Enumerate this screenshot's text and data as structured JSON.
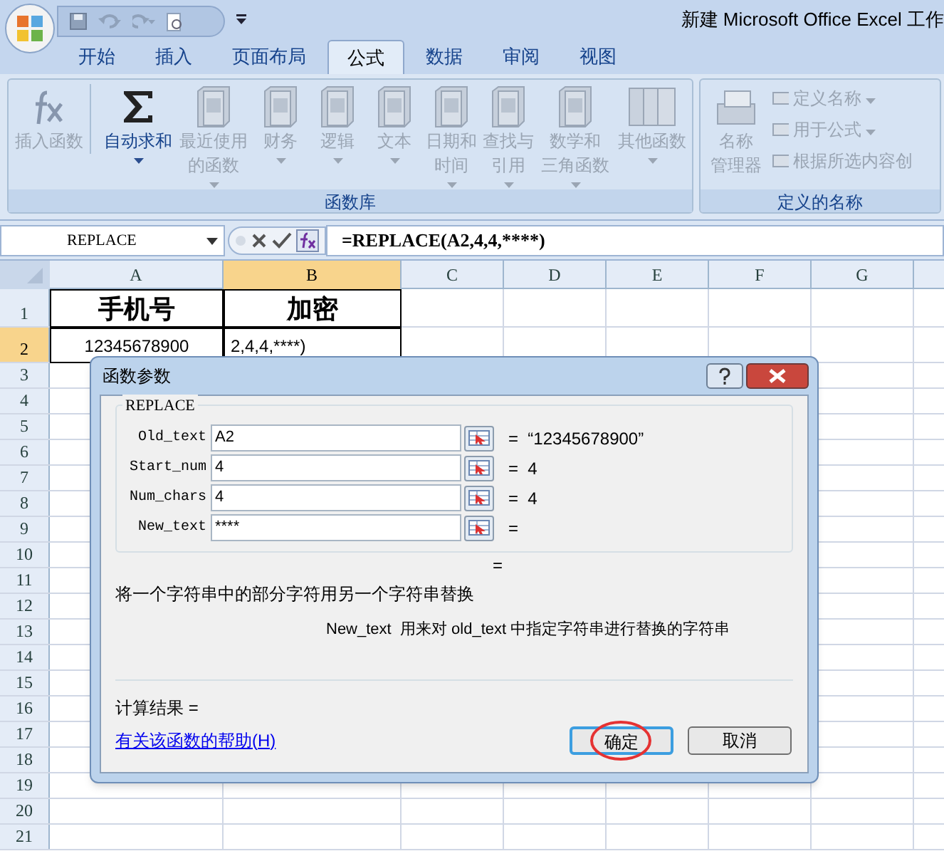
{
  "title_bar": {
    "title": "新建 Microsoft Office Excel 工作"
  },
  "ribbon_tabs": [
    {
      "label": "开始",
      "selected": false
    },
    {
      "label": "插入",
      "selected": false
    },
    {
      "label": "页面布局",
      "selected": false
    },
    {
      "label": "公式",
      "selected": true
    },
    {
      "label": "数据",
      "selected": false
    },
    {
      "label": "审阅",
      "selected": false
    },
    {
      "label": "视图",
      "selected": false
    }
  ],
  "ribbon": {
    "function_library": {
      "label": "函数库",
      "buttons": [
        {
          "kind": "fx",
          "lines": [
            "插入函数"
          ],
          "disabled": true,
          "dropdown": false
        },
        {
          "kind": "sigma",
          "lines": [
            "自动求和"
          ],
          "disabled": false,
          "dropdown": true
        },
        {
          "kind": "book",
          "lines": [
            "最近使用",
            "的函数"
          ],
          "disabled": true,
          "dropdown": true
        },
        {
          "kind": "book",
          "lines": [
            "财务"
          ],
          "disabled": true,
          "dropdown": true
        },
        {
          "kind": "book",
          "lines": [
            "逻辑"
          ],
          "disabled": true,
          "dropdown": true
        },
        {
          "kind": "book",
          "lines": [
            "文本"
          ],
          "disabled": true,
          "dropdown": true
        },
        {
          "kind": "book",
          "lines": [
            "日期和",
            "时间"
          ],
          "disabled": true,
          "dropdown": true
        },
        {
          "kind": "book",
          "lines": [
            "查找与",
            "引用"
          ],
          "disabled": true,
          "dropdown": true
        },
        {
          "kind": "book",
          "lines": [
            "数学和",
            "三角函数"
          ],
          "disabled": true,
          "dropdown": true
        },
        {
          "kind": "books",
          "lines": [
            "其他函数"
          ],
          "disabled": true,
          "dropdown": true
        }
      ]
    },
    "defined_names": {
      "label": "定义的名称",
      "manager": {
        "lines": [
          "名称",
          "管理器"
        ],
        "disabled": true
      },
      "items": [
        {
          "label": "定义名称",
          "disabled": true,
          "dropdown": true
        },
        {
          "label": "用于公式",
          "disabled": true,
          "dropdown": true
        },
        {
          "label": "根据所选内容创",
          "disabled": true,
          "dropdown": false
        }
      ]
    }
  },
  "formula_bar": {
    "name_box": "REPLACE",
    "formula": "=REPLACE(A2,4,4,****)"
  },
  "sheet": {
    "columns": [
      {
        "label": "A",
        "selected": false
      },
      {
        "label": "B",
        "selected": true
      },
      {
        "label": "C",
        "selected": false
      },
      {
        "label": "D",
        "selected": false
      },
      {
        "label": "E",
        "selected": false
      },
      {
        "label": "F",
        "selected": false
      },
      {
        "label": "G",
        "selected": false
      }
    ],
    "rows": [
      {
        "label": "1",
        "selected": false,
        "cells": [
          "手机号",
          "加密"
        ]
      },
      {
        "label": "2",
        "selected": true,
        "cells": [
          "12345678900",
          "2,4,4,****)"
        ]
      },
      {
        "label": "3",
        "selected": false
      },
      {
        "label": "4",
        "selected": false
      },
      {
        "label": "5",
        "selected": false
      },
      {
        "label": "6",
        "selected": false
      },
      {
        "label": "7",
        "selected": false
      },
      {
        "label": "8",
        "selected": false
      },
      {
        "label": "9",
        "selected": false
      },
      {
        "label": "10",
        "selected": false
      },
      {
        "label": "11",
        "selected": false
      },
      {
        "label": "12",
        "selected": false
      },
      {
        "label": "13",
        "selected": false
      },
      {
        "label": "14",
        "selected": false
      },
      {
        "label": "15",
        "selected": false
      },
      {
        "label": "16",
        "selected": false
      },
      {
        "label": "17",
        "selected": false
      },
      {
        "label": "18",
        "selected": false
      },
      {
        "label": "19",
        "selected": false
      },
      {
        "label": "20",
        "selected": false
      },
      {
        "label": "21",
        "selected": false
      }
    ]
  },
  "dialog": {
    "title": "函数参数",
    "function": "REPLACE",
    "args": [
      {
        "label": "Old_text",
        "value": "A2",
        "result": "=  “12345678900”"
      },
      {
        "label": "Start_num",
        "value": "4",
        "result": "=  4"
      },
      {
        "label": "Num_chars",
        "value": "4",
        "result": "=  4"
      },
      {
        "label": "New_text",
        "value": "****",
        "result": "="
      }
    ],
    "formula_result": "=",
    "description": "将一个字符串中的部分字符用另一个字符串替换",
    "arg_help": "New_text  用来对 old_text 中指定字符串进行替换的字符串",
    "result_label": "计算结果 =",
    "help_link": "有关该函数的帮助(H)",
    "buttons": [
      {
        "label": "确定",
        "default": true,
        "circled": true
      },
      {
        "label": "取消",
        "default": false,
        "circled": false
      }
    ]
  }
}
